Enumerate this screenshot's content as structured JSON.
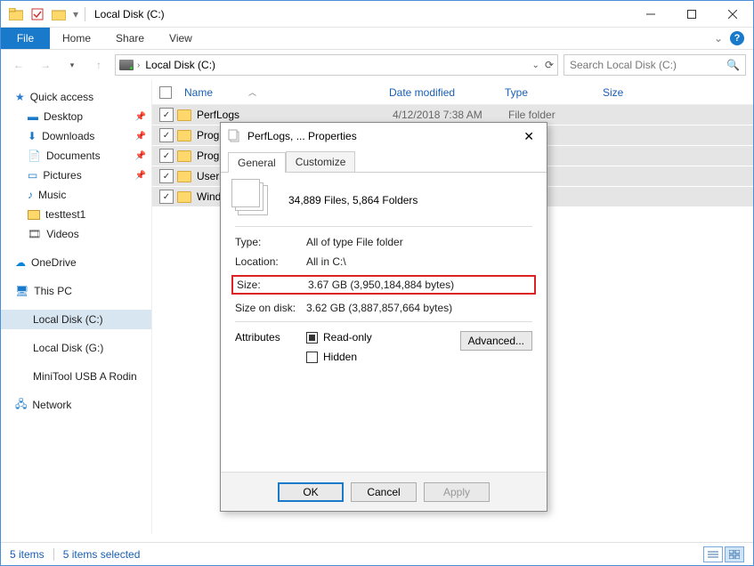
{
  "window": {
    "title": "Local Disk (C:)"
  },
  "ribbon": {
    "file": "File",
    "tabs": [
      "Home",
      "Share",
      "View"
    ]
  },
  "address": {
    "path": "Local Disk (C:)"
  },
  "search": {
    "placeholder": "Search Local Disk (C:)"
  },
  "sidebar": {
    "quick_access": "Quick access",
    "items": [
      {
        "label": "Desktop",
        "pinned": true
      },
      {
        "label": "Downloads",
        "pinned": true
      },
      {
        "label": "Documents",
        "pinned": true
      },
      {
        "label": "Pictures",
        "pinned": true
      },
      {
        "label": "Music",
        "pinned": false
      },
      {
        "label": "testtest1",
        "pinned": false
      },
      {
        "label": "Videos",
        "pinned": false
      }
    ],
    "onedrive": "OneDrive",
    "thispc": "This PC",
    "drives": [
      {
        "label": "Local Disk (C:)",
        "selected": true
      },
      {
        "label": "Local Disk (G:)",
        "selected": false
      },
      {
        "label": "MiniTool USB A Rodin",
        "selected": false
      }
    ],
    "network": "Network"
  },
  "columns": {
    "name": "Name",
    "date": "Date modified",
    "type": "Type",
    "size": "Size"
  },
  "rows": [
    {
      "name": "PerfLogs",
      "date": "4/12/2018 7:38 AM",
      "type": "File folder"
    },
    {
      "name": "Progr",
      "date": "",
      "type": "r"
    },
    {
      "name": "Progr",
      "date": "",
      "type": "r"
    },
    {
      "name": "Users",
      "date": "",
      "type": "r"
    },
    {
      "name": "Windo",
      "date": "",
      "type": "r"
    }
  ],
  "status": {
    "count": "5 items",
    "selected": "5 items selected"
  },
  "props": {
    "title": "PerfLogs, ... Properties",
    "tabs": {
      "general": "General",
      "customize": "Customize"
    },
    "summary": "34,889 Files, 5,864 Folders",
    "type_label": "Type:",
    "type_value": "All of type File folder",
    "location_label": "Location:",
    "location_value": "All in C:\\",
    "size_label": "Size:",
    "size_value": "3.67 GB (3,950,184,884 bytes)",
    "sizeondisk_label": "Size on disk:",
    "sizeondisk_value": "3.62 GB (3,887,857,664 bytes)",
    "attributes_label": "Attributes",
    "readonly": "Read-only",
    "hidden": "Hidden",
    "advanced": "Advanced...",
    "ok": "OK",
    "cancel": "Cancel",
    "apply": "Apply"
  }
}
